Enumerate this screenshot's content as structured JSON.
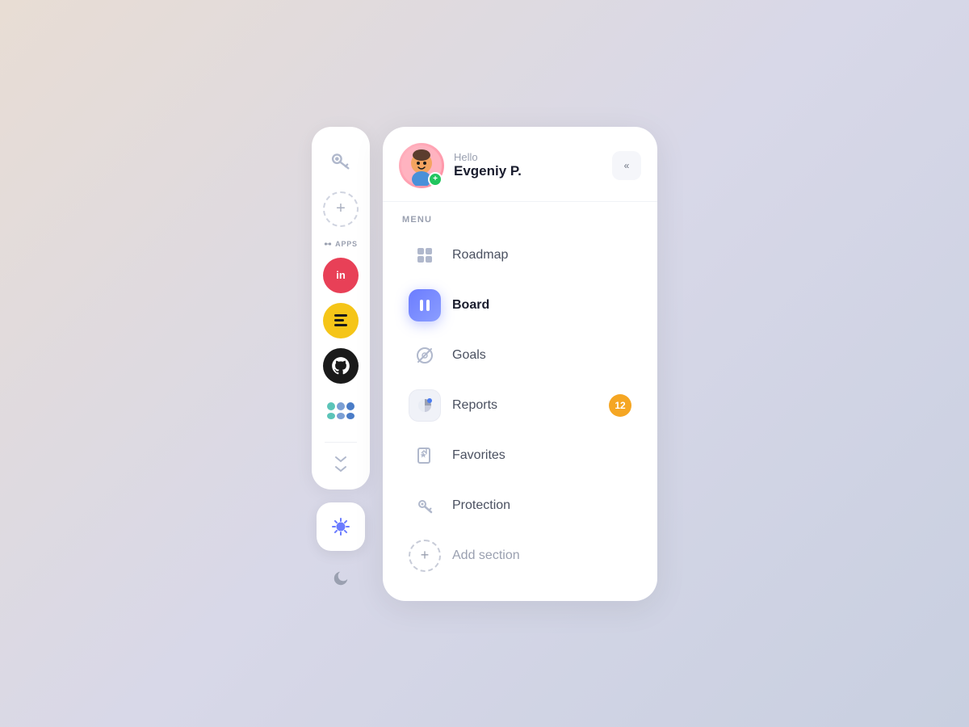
{
  "leftSidebar": {
    "addButtonLabel": "+",
    "appsLabel": "APPS",
    "chevronLabel": "›",
    "apps": [
      {
        "id": "invision",
        "label": "in",
        "bgColor": "#e84057"
      },
      {
        "id": "makerpad",
        "label": "≡≡≡",
        "bgColor": "#f5c518"
      },
      {
        "id": "github",
        "label": "github",
        "bgColor": "#1a1a1a"
      },
      {
        "id": "other",
        "label": "other",
        "bgColor": "transparent"
      }
    ]
  },
  "header": {
    "greeting": "Hello",
    "userName": "Evgeniy P.",
    "avatarEmoji": "🧒",
    "badgeLabel": "+",
    "collapseLabel": "«"
  },
  "menu": {
    "sectionLabel": "MENU",
    "items": [
      {
        "id": "roadmap",
        "label": "Roadmap",
        "active": false,
        "badge": null
      },
      {
        "id": "board",
        "label": "Board",
        "active": true,
        "badge": null
      },
      {
        "id": "goals",
        "label": "Goals",
        "active": false,
        "badge": null
      },
      {
        "id": "reports",
        "label": "Reports",
        "active": false,
        "badge": "12"
      },
      {
        "id": "favorites",
        "label": "Favorites",
        "active": false,
        "badge": null
      },
      {
        "id": "protection",
        "label": "Protection",
        "active": false,
        "badge": null
      },
      {
        "id": "add-section",
        "label": "Add section",
        "active": false,
        "badge": null
      }
    ]
  },
  "theme": {
    "sunLabel": "☀",
    "moonLabel": "🌙"
  }
}
